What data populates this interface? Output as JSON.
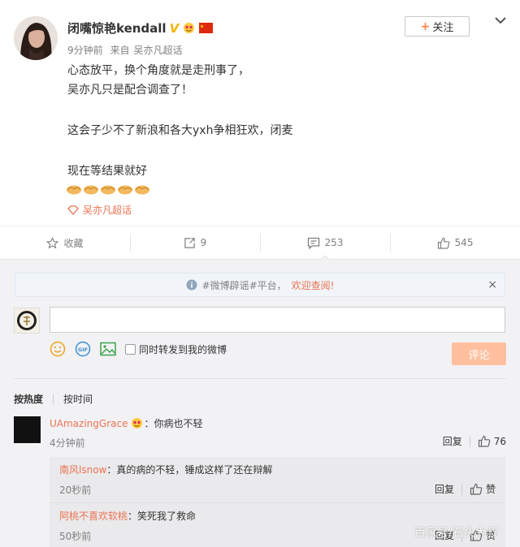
{
  "post": {
    "username": "闭嘴惊艳kendall",
    "verified_mark": "V",
    "time": "9分钟前",
    "source_prefix": "来自",
    "source": "吴亦凡超话",
    "follow_label": "关注",
    "follow_plus": "+",
    "content": {
      "line1": "心态放平，换个角度就是走刑事了，",
      "line2": "吴亦凡只是配合调查了！",
      "line3": "这会子少不了新浪和各大yxh争相狂欢，闭麦",
      "line4": "现在等结果就好"
    },
    "emoji_count": 5,
    "topic": "吴亦凡超话"
  },
  "actions": {
    "favorite_label": "收藏",
    "repost_count": "9",
    "comment_count": "253",
    "like_count": "545"
  },
  "comments_panel": {
    "notice_text": "#微博辟谣#平台，",
    "notice_link": "欢迎查阅!",
    "notice_close": "×",
    "input_value": "",
    "repost_option": "同时转发到我的微博",
    "submit_label": "评论",
    "sort_hot": "按热度",
    "sort_time": "按时间"
  },
  "comments": [
    {
      "user": "UAmazingGrace",
      "text": "：你病也不轻",
      "time": "4分钟前",
      "reply_label": "回复",
      "likes": "76"
    }
  ],
  "replies": [
    {
      "user": "南风lsnow",
      "text": "：真的病的不轻，锤成这样了还在辩解",
      "time": "20秒前",
      "reply_label": "回复",
      "like_label": "赞"
    },
    {
      "user": "阿桃不喜欢软桃",
      "text": "：笑死我了救命",
      "time": "50秒前",
      "reply_label": "回复",
      "like_label": "赞"
    }
  ],
  "watermark": "百家号/石头大叔",
  "colors": {
    "accent": "#eb7350",
    "verified": "#f7b500",
    "submit_disabled": "#ffc09f",
    "panel_bg": "#f2f2f5"
  }
}
